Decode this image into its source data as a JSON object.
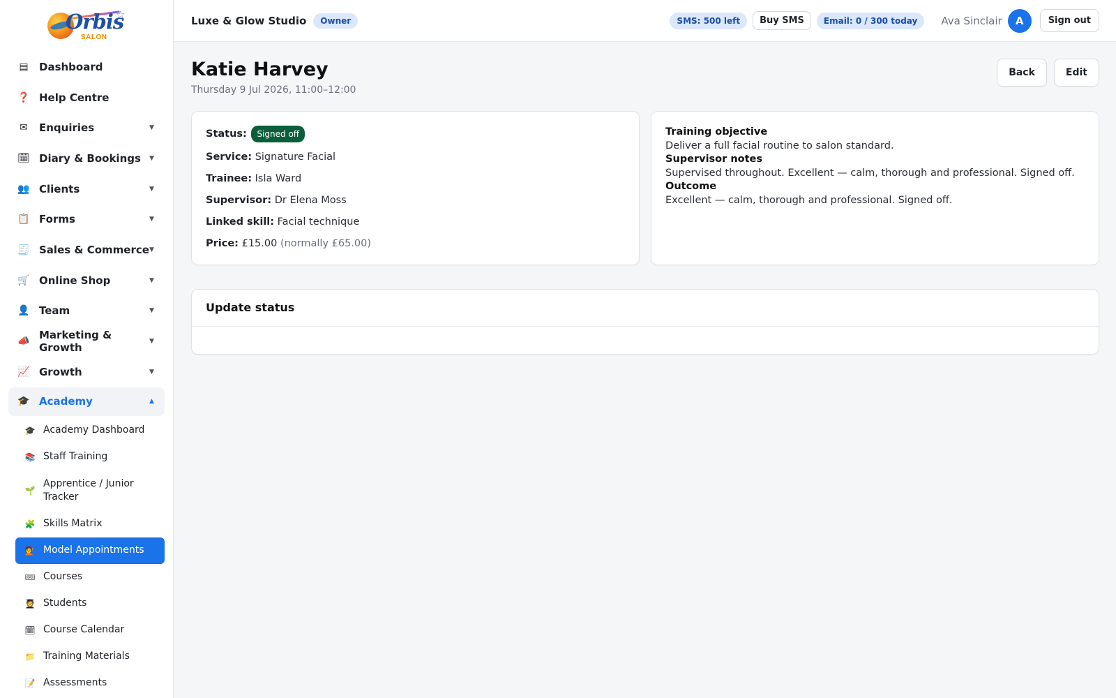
{
  "sidebar": {
    "logo": {
      "text": "rbis",
      "sub": "SALON",
      "letter": "O"
    },
    "items": [
      {
        "label": "Dashboard",
        "icon": "▤",
        "icon_name": "dashboard-icon",
        "chevron": ""
      },
      {
        "label": "Help Centre",
        "icon": "❓",
        "icon_name": "help-icon",
        "chevron": ""
      },
      {
        "label": "Enquiries",
        "icon": "✉",
        "icon_name": "envelope-icon",
        "chevron": "▼"
      },
      {
        "label": "Diary & Bookings",
        "icon": "🗓",
        "icon_name": "calendar-icon",
        "chevron": "▼"
      },
      {
        "label": "Clients",
        "icon": "👥",
        "icon_name": "clients-icon",
        "chevron": "▼"
      },
      {
        "label": "Forms",
        "icon": "📋",
        "icon_name": "clipboard-icon",
        "chevron": "▼"
      },
      {
        "label": "Sales & Commerce",
        "icon": "🧾",
        "icon_name": "receipt-icon",
        "chevron": "▼"
      },
      {
        "label": "Online Shop",
        "icon": "🛒",
        "icon_name": "cart-icon",
        "chevron": "▼"
      },
      {
        "label": "Team",
        "icon": "👤",
        "icon_name": "team-icon",
        "chevron": "▼"
      },
      {
        "label": "Marketing & Growth",
        "icon": "📣",
        "icon_name": "megaphone-icon",
        "chevron": "▼"
      },
      {
        "label": "Growth",
        "icon": "📈",
        "icon_name": "chart-up-icon",
        "chevron": "▼"
      }
    ],
    "academy": {
      "label": "Academy",
      "icon": "🎓",
      "chevron": "▲"
    },
    "sub_items": [
      {
        "label": "Academy Dashboard",
        "icon": "🎓"
      },
      {
        "label": "Staff Training",
        "icon": "📚"
      },
      {
        "label": "Apprentice / Junior Tracker",
        "icon": "🌱"
      },
      {
        "label": "Skills Matrix",
        "icon": "🧩"
      },
      {
        "label": "Model Appointments",
        "icon": "💇"
      },
      {
        "label": "Courses",
        "icon": "🎟"
      },
      {
        "label": "Students",
        "icon": "🧑‍🎓"
      },
      {
        "label": "Course Calendar",
        "icon": "🗓"
      },
      {
        "label": "Training Materials",
        "icon": "📁"
      },
      {
        "label": "Assessments",
        "icon": "📝"
      }
    ]
  },
  "topbar": {
    "studio": "Luxe & Glow Studio",
    "role": "Owner",
    "sms": "SMS: 500 left",
    "buy_sms": "Buy SMS",
    "email": "Email: 0 / 300 today",
    "user": "Ava Sinclair",
    "avatar": "A",
    "sign_out": "Sign out"
  },
  "page": {
    "title": "Katie Harvey",
    "subtitle": "Thursday 9 Jul 2026, 11:00–12:00",
    "back": "Back",
    "edit": "Edit"
  },
  "details": {
    "status_label": "Status:",
    "status": "Signed off",
    "service_label": "Service:",
    "service": "Signature Facial",
    "trainee_label": "Trainee:",
    "trainee": "Isla Ward",
    "supervisor_label": "Supervisor:",
    "supervisor": "Dr Elena Moss",
    "skill_label": "Linked skill:",
    "skill": "Facial technique",
    "price_label": "Price:",
    "price": "£15.00",
    "price_normal": "(normally £65.00)"
  },
  "notes": {
    "objective_label": "Training objective",
    "objective": "Deliver a full facial routine to salon standard.",
    "supervisor_label": "Supervisor notes",
    "supervisor": "Supervised throughout. Excellent — calm, thorough and professional. Signed off.",
    "outcome_label": "Outcome",
    "outcome": "Excellent — calm, thorough and professional. Signed off."
  },
  "update": {
    "title": "Update status"
  },
  "colors": {
    "accent": "#1a73e8",
    "status_signed_off": "#0b5e3a"
  }
}
